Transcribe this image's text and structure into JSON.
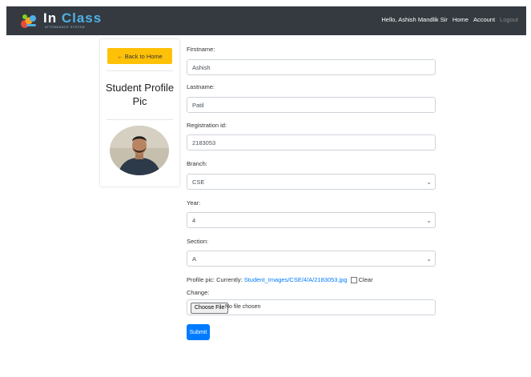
{
  "navbar": {
    "brand_prefix": "In ",
    "brand_accent": "Class",
    "brand_subtitle": "ATTENDANCE SYSTEM",
    "greeting": "Hello, Ashish Mandlik Sir",
    "home": "Home",
    "account": "Account",
    "logout": "Logout",
    "bg_color": "#343a40"
  },
  "card": {
    "back_label": "← Back to Home",
    "title": "Student Profile Pic",
    "back_color": "#ffc107"
  },
  "form": {
    "firstname_label": "Firstname:",
    "firstname_value": "Ashish",
    "lastname_label": "Lastname:",
    "lastname_value": "Patil",
    "regid_label": "Registration id:",
    "regid_value": "2183053",
    "branch_label": "Branch:",
    "branch_value": "CSE",
    "year_label": "Year:",
    "year_value": "4",
    "section_label": "Section:",
    "section_value": "A",
    "profile_label": "Profile pic: Currently: ",
    "profile_link": "Student_Images/CSE/4/A/2183053.jpg",
    "clear_label": "Clear",
    "change_label": "Change:",
    "choose_file": "Choose File",
    "no_file": "No file chosen",
    "submit": "Submit",
    "submit_color": "#007bff"
  }
}
